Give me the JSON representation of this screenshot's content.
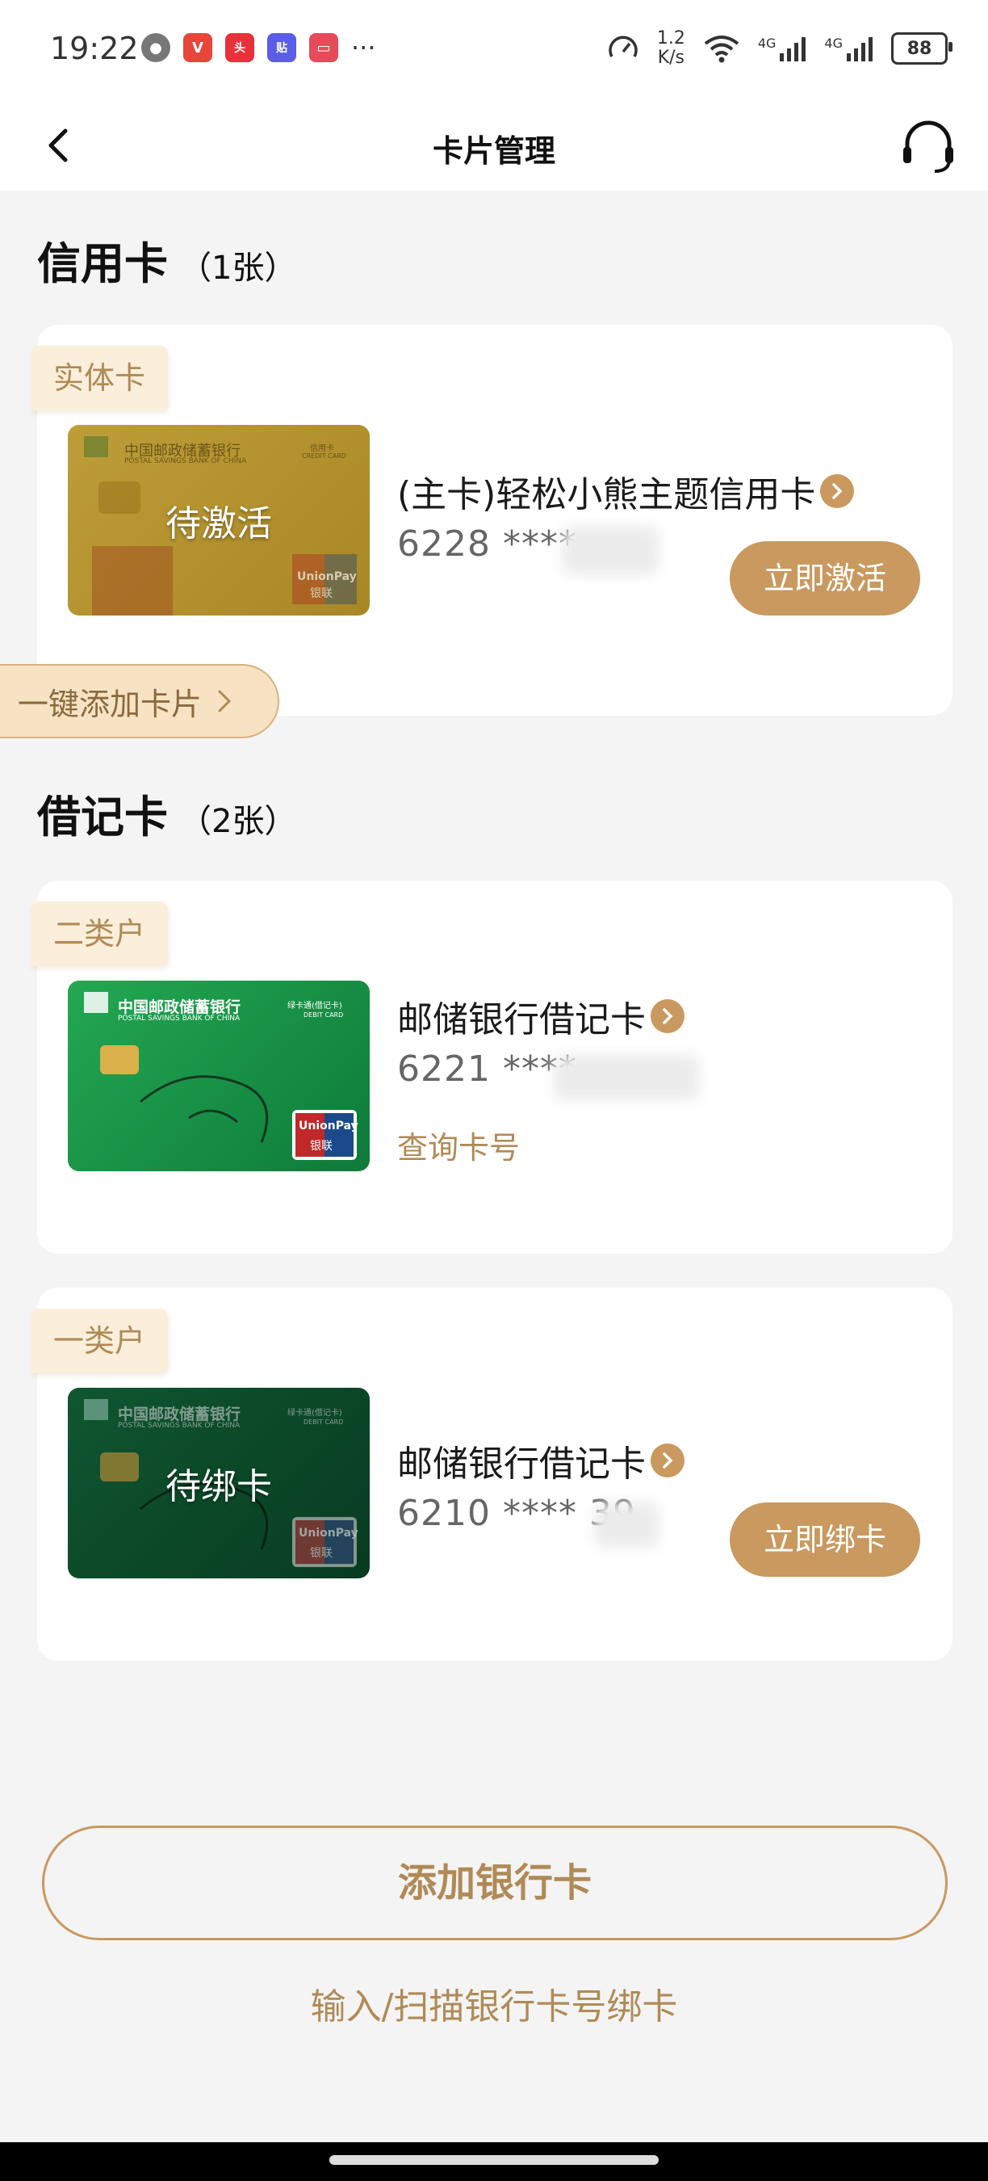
{
  "status_bar": {
    "time": "19:22",
    "net_speed_value": "1.2",
    "net_speed_unit": "K/s",
    "signal1": "4G",
    "signal2": "4G",
    "battery": "88",
    "more": "···"
  },
  "nav": {
    "title": "卡片管理"
  },
  "credit_section": {
    "title": "信用卡",
    "count": "（1张）",
    "cards": [
      {
        "tag": "实体卡",
        "name": "(主卡)轻松小熊主题信用卡",
        "number": "6228 ****",
        "overlay": "待激活",
        "action": "立即激活",
        "card_color": "#c9a640"
      }
    ]
  },
  "quick_add": {
    "label": "一键添加卡片"
  },
  "debit_section": {
    "title": "借记卡",
    "count": "（2张）",
    "cards": [
      {
        "tag": "二类户",
        "name": "邮储银行借记卡",
        "number": "6221 ****",
        "link": "查询卡号",
        "card_color": "#1a9a4a"
      },
      {
        "tag": "一类户",
        "name": "邮储银行借记卡",
        "number": "6210 **** 39",
        "overlay": "待绑卡",
        "action": "立即绑卡",
        "card_color": "#0f5a34"
      }
    ]
  },
  "card_face": {
    "bank_cn": "中国邮政储蓄银行",
    "bank_en": "POSTAL SAVINGS BANK OF CHINA",
    "unionpay": "UnionPay",
    "unionpay_cn": "银联",
    "credit_type": "CREDIT CARD",
    "debit_type": "DEBIT CARD",
    "debit_label": "绿卡通(借记卡)",
    "credit_label": "信用卡"
  },
  "footer": {
    "add_button": "添加银行卡",
    "scan_link": "输入/扫描银行卡号绑卡"
  }
}
